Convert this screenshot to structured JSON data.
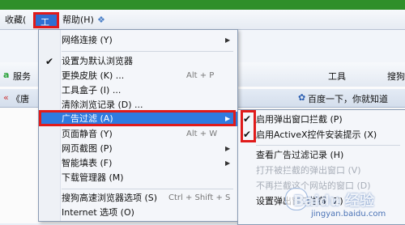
{
  "menubar": {
    "favorites": "收藏(",
    "tools": "工具(T)",
    "help": "帮助(H)"
  },
  "background": {
    "left_label": "服务",
    "tab1": "《唐",
    "tab2": "百度一下，你就知道",
    "tools_btn": "工具",
    "search_btn": "搜狗"
  },
  "tools_menu": {
    "items": [
      {
        "label": "网络连接 (Y)",
        "shortcut": "",
        "arrow": true
      },
      {
        "label": "设置为默认浏览器",
        "shortcut": "",
        "checked": true
      },
      {
        "label": "更换皮肤 (K) ...",
        "shortcut": "Alt + P"
      },
      {
        "label": "工具盒子 (I) ...",
        "shortcut": ""
      },
      {
        "label": "清除浏览记录 (D) ...",
        "shortcut": ""
      },
      {
        "label": "广告过滤 (A)",
        "shortcut": "",
        "arrow": true,
        "highlighted": true
      },
      {
        "label": "页面静音 (Y)",
        "shortcut": "Alt + W"
      },
      {
        "label": "网页截图 (P)",
        "shortcut": "",
        "arrow": true
      },
      {
        "label": "智能填表 (F)",
        "shortcut": "",
        "arrow": true
      },
      {
        "label": "下载管理器 (M)",
        "shortcut": ""
      },
      {
        "label": "搜狗高速浏览器选项 (S)",
        "shortcut": "Ctrl + Shift + S"
      },
      {
        "label": "Internet 选项 (O)",
        "shortcut": ""
      }
    ]
  },
  "ad_submenu": {
    "items": [
      {
        "label": "启用弹出窗口拦截 (P)",
        "checked": true
      },
      {
        "label": "启用ActiveX控件安装提示 (X)",
        "checked": true
      },
      {
        "label": "查看广告过滤记录 (H)",
        "checked": false
      },
      {
        "label": "打开被拦截的弹出窗口 (V)",
        "disabled": true
      },
      {
        "label": "不再拦截这个网站的窗口 (D)",
        "disabled": true
      },
      {
        "label": "设置弹出窗口拦截 (Z)",
        "disabled": false
      }
    ]
  },
  "watermark": {
    "text": "Baidu 经验",
    "url": "jingyan.baidu.com"
  },
  "colors": {
    "highlight": "#2f7be0",
    "annotation": "#e01b1b"
  }
}
